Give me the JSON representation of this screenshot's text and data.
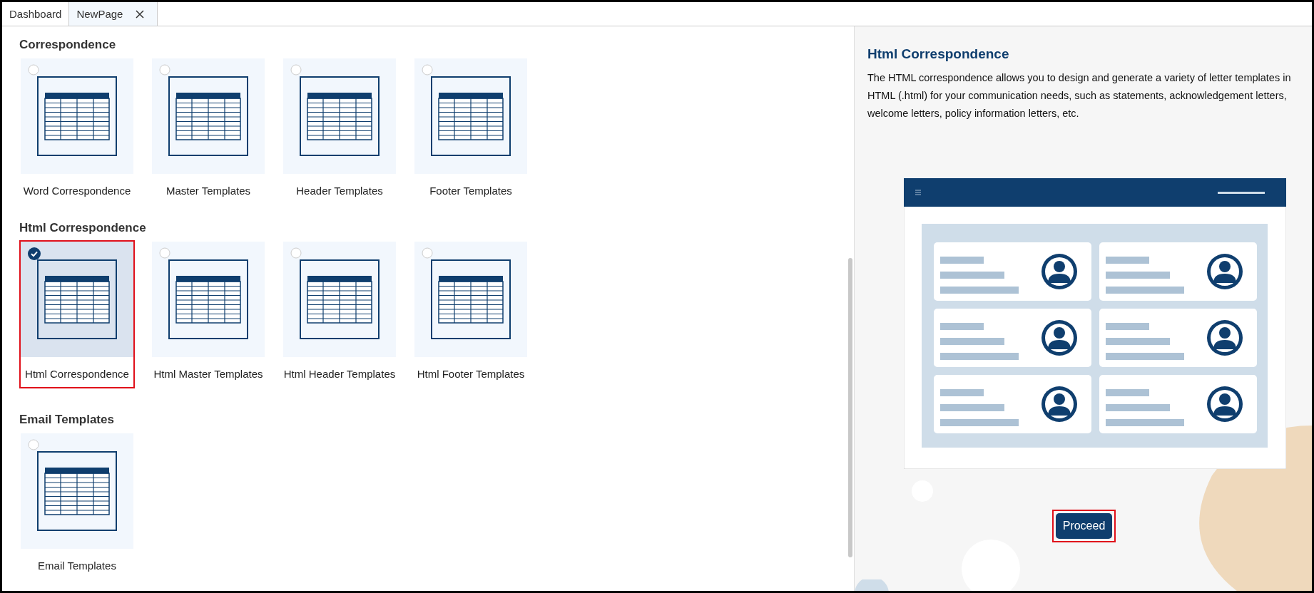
{
  "tabs": [
    {
      "label": "Dashboard",
      "selected": false,
      "closable": false
    },
    {
      "label": "NewPage",
      "selected": true,
      "closable": true
    }
  ],
  "sections": [
    {
      "title": "Correspondence",
      "items": [
        {
          "label": "Word Correspondence",
          "selected": false
        },
        {
          "label": "Master Templates",
          "selected": false
        },
        {
          "label": "Header Templates",
          "selected": false
        },
        {
          "label": "Footer Templates",
          "selected": false
        }
      ]
    },
    {
      "title": "Html Correspondence",
      "items": [
        {
          "label": "Html Correspondence",
          "selected": true
        },
        {
          "label": "Html Master Templates",
          "selected": false
        },
        {
          "label": "Html Header Templates",
          "selected": false
        },
        {
          "label": "Html Footer Templates",
          "selected": false
        }
      ]
    },
    {
      "title": "Email Templates",
      "items": [
        {
          "label": "Email Templates",
          "selected": false
        }
      ]
    }
  ],
  "detail": {
    "title": "Html Correspondence",
    "description": "The HTML correspondence allows you to design and generate a variety of letter templates in HTML (.html) for your communication needs, such as statements, acknowledgement letters, welcome letters, policy information letters, etc."
  },
  "proceed_button": {
    "label": "Proceed",
    "highlighted": true
  }
}
